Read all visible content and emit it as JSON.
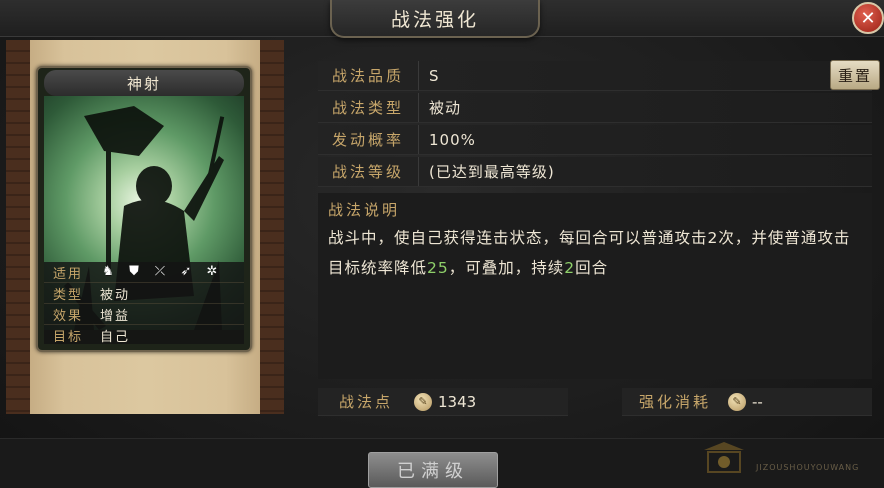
{
  "window": {
    "title": "战法强化",
    "close_label": "✕"
  },
  "card": {
    "name": "神射",
    "info": [
      {
        "key": "适用",
        "value": ""
      },
      {
        "key": "类型",
        "value": "被动"
      },
      {
        "key": "效果",
        "value": "增益"
      },
      {
        "key": "目标",
        "value": "自己"
      }
    ],
    "troop_icons": [
      "cavalry-icon",
      "shield-icon",
      "bow-icon",
      "spear-icon",
      "wheel-icon"
    ]
  },
  "details": {
    "rows": [
      {
        "key": "战法品质",
        "value": "S"
      },
      {
        "key": "战法类型",
        "value": "被动"
      },
      {
        "key": "发动概率",
        "value": "100%"
      },
      {
        "key": "战法等级",
        "value": "(已达到最高等级)"
      }
    ],
    "reset_label": "重置",
    "description_title": "战法说明",
    "description_parts": [
      "战斗中，使自己获得连击状态，每回合可以普通攻击2次，并使普通攻击目标统率降低",
      "25",
      "，可叠加，持续",
      "2",
      "回合"
    ]
  },
  "points": {
    "label": "战法点",
    "value": "1343",
    "cost_label": "强化消耗",
    "cost_value": "--"
  },
  "footer": {
    "max_level_label": "已满级"
  },
  "watermark": {
    "text": "JIZOUSHOUYOUWANG"
  },
  "colors": {
    "label_gold": "#c7a66a",
    "highlight_green": "#8fd06a",
    "close_red": "#9a2014"
  }
}
